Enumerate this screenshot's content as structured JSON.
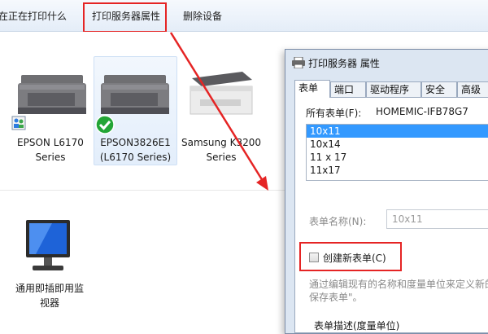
{
  "toolbar": {
    "see_printing": "在正在打印什么",
    "print_server_props": "打印服务器属性",
    "remove_device": "删除设备"
  },
  "devices": [
    {
      "line1": "EPSON L6170",
      "line2": "Series"
    },
    {
      "line1": "EPSON3826E1",
      "line2": "(L6170 Series)",
      "status": "default"
    },
    {
      "line1": "Samsung K3200",
      "line2": "Series"
    },
    {
      "line1": "通用即插即用监",
      "line2": "视器"
    }
  ],
  "dialog": {
    "title": "打印服务器 属性",
    "tabs": [
      "表单",
      "端口",
      "驱动程序",
      "安全",
      "高级"
    ],
    "active_tab": "表单",
    "all_forms_label": "所有表单(F):",
    "server_name": "HOMEMIC-IFB78G7",
    "forms": [
      "10x11",
      "10x14",
      "11 x 17",
      "11x17"
    ],
    "selected_form": "10x11",
    "form_name_label": "表单名称(N):",
    "form_name_value": "10x11",
    "create_new_form_label": "创建新表单(C)",
    "create_new_form_checked": false,
    "description": "通过编辑现有的名称和度量单位来定义新的",
    "description_line2": "保存表单\"。",
    "section_label": "表单描述(度量单位)"
  },
  "colors": {
    "highlight": "#e52424",
    "selection": "#3399ff"
  }
}
